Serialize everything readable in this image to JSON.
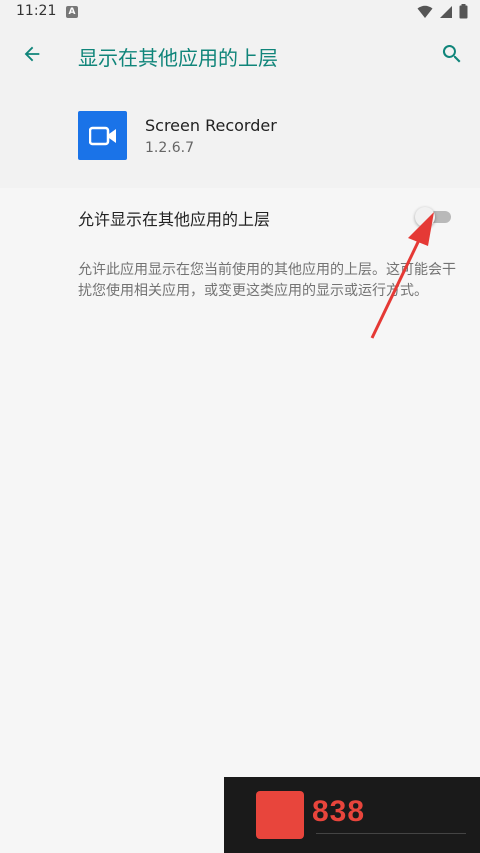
{
  "status_bar": {
    "time": "11:21",
    "notification_icon": "a-letter-icon",
    "right_icons": [
      "wifi-icon",
      "signal-icon",
      "battery-icon"
    ]
  },
  "app_bar": {
    "title": "显示在其他应用的上层",
    "back_icon": "arrow-back-icon",
    "search_icon": "search-icon"
  },
  "app_info": {
    "name": "Screen Recorder",
    "version": "1.2.6.7",
    "icon": "video-camera-icon"
  },
  "setting": {
    "label": "允许显示在其他应用的上层",
    "toggle_on": false,
    "description": "允许此应用显示在您当前使用的其他应用的上层。这可能会干扰您使用相关应用，或变更这类应用的显示或运行方式。"
  },
  "watermark": {
    "text": "838"
  },
  "colors": {
    "accent": "#10857a",
    "app_icon_bg": "#1a73e8",
    "annotation_arrow": "#e53935"
  }
}
